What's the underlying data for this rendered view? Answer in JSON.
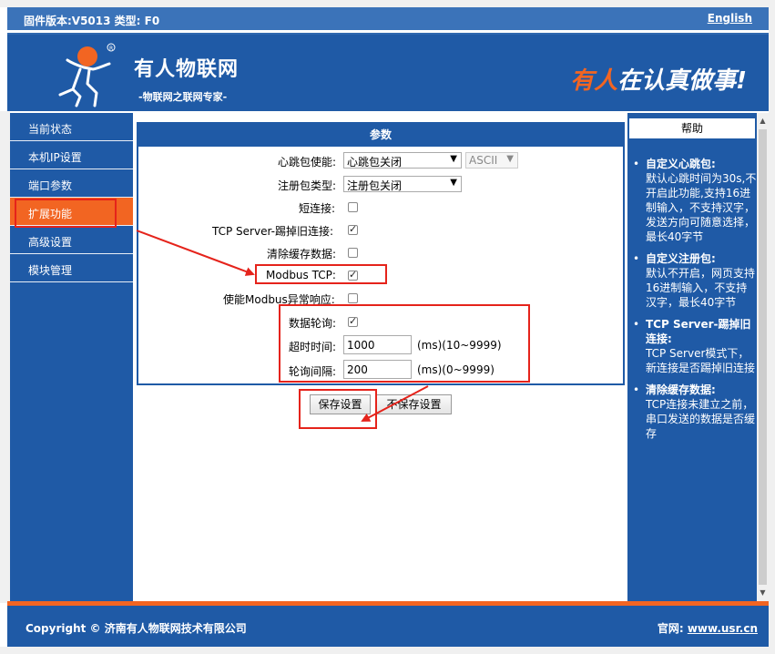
{
  "topbar": {
    "firmware": "固件版本:V5013 类型: F0",
    "language_link": "English"
  },
  "header": {
    "brand": "有人物联网",
    "subtitle": "-物联网之联网专家-",
    "slogan_orange": "有人",
    "slogan_white": "在认真做事!"
  },
  "sidebar": {
    "items": [
      {
        "label": "当前状态"
      },
      {
        "label": "本机IP设置"
      },
      {
        "label": "端口参数"
      },
      {
        "label": "扩展功能"
      },
      {
        "label": "高级设置"
      },
      {
        "label": "模块管理"
      }
    ],
    "active_index": 3
  },
  "params": {
    "header": "参数",
    "heartbeat_label": "心跳包使能:",
    "heartbeat_value": "心跳包关闭",
    "heartbeat_format": "ASCII",
    "register_label": "注册包类型:",
    "register_value": "注册包关闭",
    "short_conn_label": "短连接:",
    "tcp_kick_label": "TCP Server-踢掉旧连接:",
    "clear_cache_label": "清除缓存数据:",
    "modbus_tcp_label": "Modbus TCP:",
    "modbus_exc_label": "使能Modbus异常响应:",
    "polling_label": "数据轮询:",
    "timeout_label": "超时时间:",
    "timeout_value": "1000",
    "timeout_unit": "(ms)(10~9999)",
    "interval_label": "轮询间隔:",
    "interval_value": "200",
    "interval_unit": "(ms)(0~9999)"
  },
  "checkboxes": {
    "short_conn": false,
    "tcp_kick": true,
    "clear_cache": false,
    "modbus_tcp": true,
    "modbus_exc": false,
    "polling": true
  },
  "buttons": {
    "save": "保存设置",
    "no_save": "不保存设置"
  },
  "help": {
    "title": "帮助",
    "items": [
      {
        "title": "自定义心跳包:",
        "text": "默认心跳时间为30s,不开启此功能,支持16进制输入，不支持汉字，发送方向可随意选择，最长40字节"
      },
      {
        "title": "自定义注册包:",
        "text": "默认不开启，网页支持16进制输入，不支持汉字，最长40字节"
      },
      {
        "title": "TCP Server-踢掉旧连接:",
        "text": "TCP Server模式下，新连接是否踢掉旧连接"
      },
      {
        "title": "清除缓存数据:",
        "text": "TCP连接未建立之前，串口发送的数据是否缓存"
      }
    ]
  },
  "footer": {
    "copyright": "Copyright © 济南有人物联网技术有限公司",
    "site_label": "官网:",
    "site_link": "www.usr.cn"
  },
  "colors": {
    "primary": "#1f5aa6",
    "topbar": "#3b73b9",
    "accent": "#f26522",
    "annotation": "#e5231b"
  }
}
